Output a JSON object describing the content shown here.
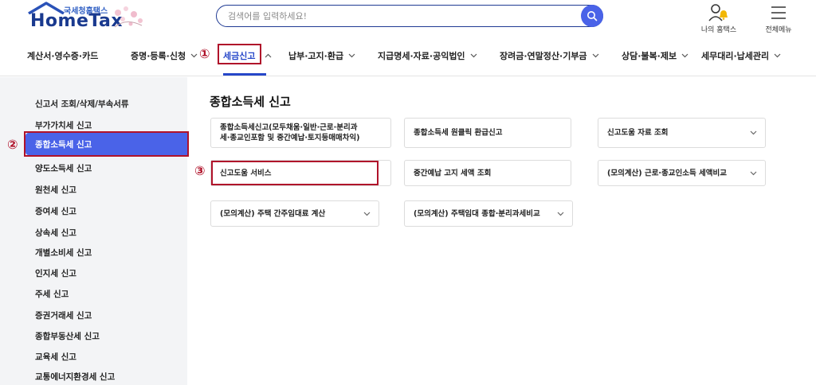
{
  "header": {
    "logo_sub": "국세청홈택스",
    "logo_main": "HomeTax",
    "search_placeholder": "검색어를 입력하세요!",
    "my_hometax": "나의 홈택스",
    "all_menu": "전체메뉴"
  },
  "nav": {
    "items": [
      "계산서·영수증·카드",
      "증명·등록·신청",
      "세금신고",
      "납부·고지·환급",
      "지급명세·자료·공익법인",
      "장려금·연말정산·기부금",
      "상담·불복·제보",
      "세무대리·납세관리"
    ],
    "active": "세금신고"
  },
  "annotations": {
    "n1": "①",
    "n2": "②",
    "n3": "③"
  },
  "sidebar": {
    "items": [
      "신고서 조회/삭제/부속서류",
      "부가가치세 신고",
      "종합소득세 신고",
      "양도소득세 신고",
      "원천세 신고",
      "증여세 신고",
      "상속세 신고",
      "개별소비세 신고",
      "인지세 신고",
      "주세 신고",
      "증권거래세 신고",
      "종합부동산세 신고",
      "교육세 신고",
      "교통에너지환경세 신고"
    ],
    "active": "종합소득세 신고"
  },
  "main": {
    "title": "종합소득세 신고",
    "cards": [
      "종합소득세신고(모두채움·일반·근로·분리과세·종교인포함 및 중간예납·토지등매매차익)",
      "종합소득세 원클릭 환급신고",
      "신고도움 자료 조회",
      "신고도움 서비스",
      "중간예납 고지 세액 조회",
      "(모의계산) 근로·종교인소득 세액비교",
      "(모의계산) 주택 간주임대료 계산",
      "(모의계산) 주택임대 종합·분리과세비교"
    ],
    "card1_line1": "종합소득세신고(모두채움·일반·근로·분리과",
    "card1_line2": "세·종교인포함 및 중간예납·토지등매매차익)"
  },
  "colors": {
    "brand_blue": "#2647c9",
    "active_bg": "#4a63e8",
    "annotation_red": "#b0122a",
    "sidebar_bg": "#f3f4f6"
  }
}
